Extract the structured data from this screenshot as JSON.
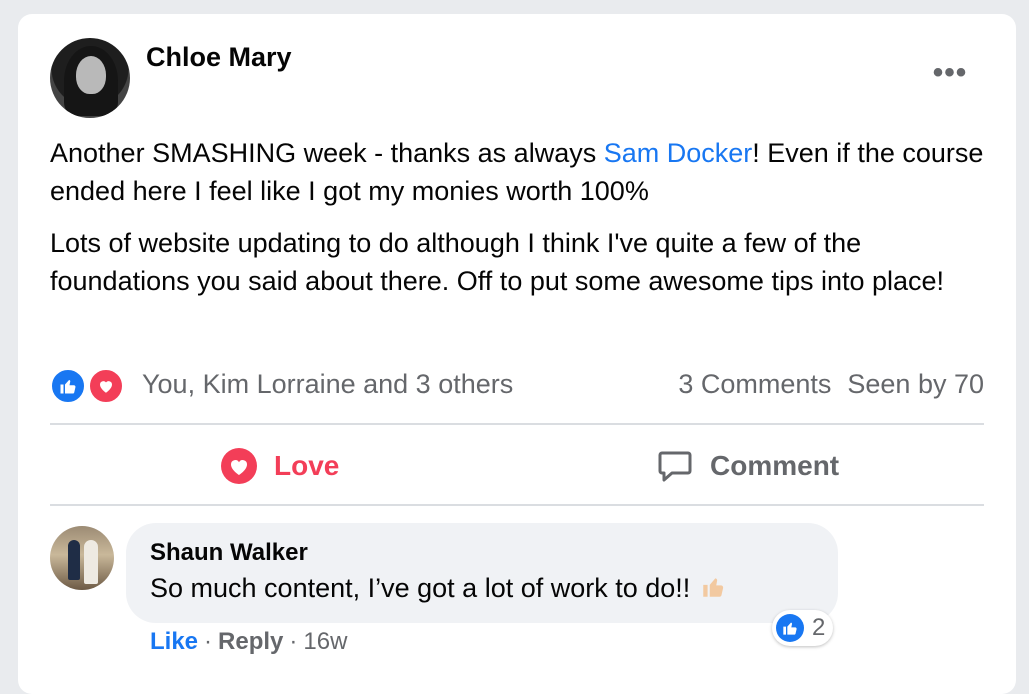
{
  "post": {
    "author": "Chloe Mary",
    "text_line1_before": "Another SMASHING week - thanks as always ",
    "mention": "Sam Docker",
    "text_line1_after": "! Even if the course ended here I feel like I got my monies worth 100%",
    "paragraph2": "Lots of website updating to do although I think I've quite a few of the foundations you said about there. Off to put some awesome tips into place!",
    "more_label": "•••"
  },
  "reactions": {
    "summary": "You, Kim Lorraine and 3 others",
    "comments": "3 Comments",
    "seen_by": "Seen by 70",
    "icons": [
      "like-icon",
      "love-icon"
    ]
  },
  "actions": {
    "love_label": "Love",
    "comment_label": "Comment"
  },
  "comment": {
    "author": "Shaun Walker",
    "text": "So much content, I’ve got a lot of work to do!!",
    "reaction_count": "2",
    "like_label": "Like",
    "separator": "·",
    "reply_label": "Reply",
    "time": "16w"
  },
  "colors": {
    "accent": "#1877f2",
    "love": "#f33e58",
    "muted": "#65676b",
    "bubble": "#f0f2f5"
  }
}
